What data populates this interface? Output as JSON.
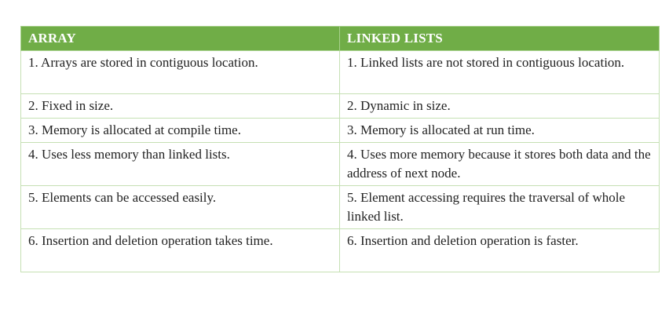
{
  "table": {
    "headers": [
      "ARRAY",
      "LINKED LISTS"
    ],
    "rows": [
      [
        "1. Arrays are stored in contiguous location.",
        "1. Linked lists are not stored in contiguous location."
      ],
      [
        "2. Fixed in size.",
        "2. Dynamic in size."
      ],
      [
        "3. Memory is allocated at compile time.",
        "3. Memory is allocated at run time."
      ],
      [
        "4. Uses less memory than linked lists.",
        "4. Uses more memory because it stores both data and the address of next node."
      ],
      [
        "5. Elements can be accessed easily.",
        "5. Element accessing requires the traversal of whole linked list."
      ],
      [
        "6. Insertion and deletion operation takes time.",
        "6. Insertion and deletion operation is faster."
      ]
    ]
  },
  "colors": {
    "header_bg": "#70ad47",
    "header_text": "#ffffff",
    "border": "#c5e0b3"
  }
}
